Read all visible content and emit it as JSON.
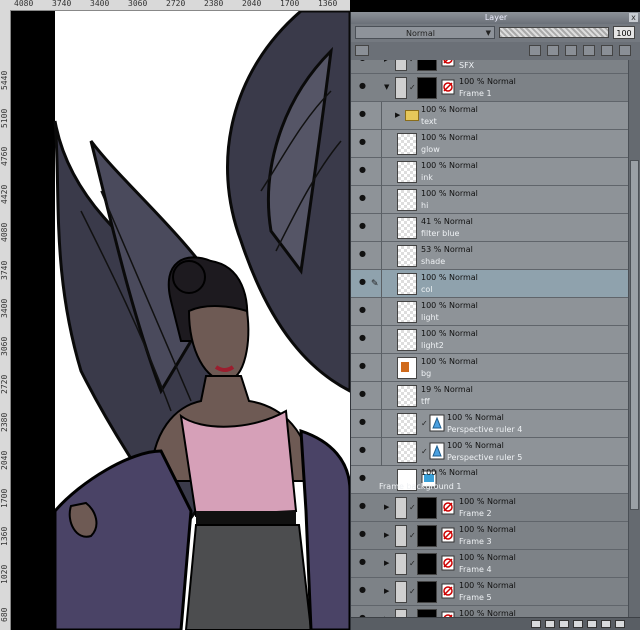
{
  "ruler": {
    "top_ticks": [
      "4080",
      "3740",
      "3400",
      "3060",
      "2720",
      "2380",
      "2040",
      "1700",
      "1360"
    ],
    "left_ticks": [
      "5440",
      "5100",
      "4760",
      "4420",
      "4080",
      "3740",
      "3400",
      "3060",
      "2720",
      "2380",
      "2040",
      "1700",
      "1360",
      "1020",
      "680",
      "340"
    ]
  },
  "panel": {
    "title": "Layer",
    "blend_mode": "Normal",
    "opacity": "100",
    "close_glyph": "x"
  },
  "layers": [
    {
      "name": "SFX",
      "opacity": "",
      "type": "partial"
    },
    {
      "name": "Frame 1",
      "opacity": "100 %  Normal",
      "type": "frame-open"
    },
    {
      "name": "text",
      "opacity": "100 %  Normal",
      "type": "folder"
    },
    {
      "name": "glow",
      "opacity": "100 %  Normal",
      "type": "raster"
    },
    {
      "name": "ink",
      "opacity": "100 %  Normal",
      "type": "raster"
    },
    {
      "name": "hi",
      "opacity": "100 %  Normal",
      "type": "raster"
    },
    {
      "name": "filter blue",
      "opacity": "41 %  Normal",
      "type": "raster"
    },
    {
      "name": "shade",
      "opacity": "53 %  Normal",
      "type": "raster"
    },
    {
      "name": "col",
      "opacity": "100 %  Normal",
      "type": "selected"
    },
    {
      "name": "light",
      "opacity": "100 %  Normal",
      "type": "raster"
    },
    {
      "name": "light2",
      "opacity": "100 %  Normal",
      "type": "raster"
    },
    {
      "name": "bg",
      "opacity": "100 %  Normal",
      "type": "raster-orange"
    },
    {
      "name": "tff",
      "opacity": "19 %  Normal",
      "type": "raster"
    },
    {
      "name": "Perspective ruler 4",
      "opacity": "100 %  Normal",
      "type": "perspective"
    },
    {
      "name": "Perspective ruler 5",
      "opacity": "100 %  Normal",
      "type": "perspective"
    },
    {
      "name": "Frame background 1",
      "opacity": "100 %  Normal",
      "type": "background"
    },
    {
      "name": "Frame 2",
      "opacity": "100 %  Normal",
      "type": "frame"
    },
    {
      "name": "Frame 3",
      "opacity": "100 %  Normal",
      "type": "frame"
    },
    {
      "name": "Frame 4",
      "opacity": "100 %  Normal",
      "type": "frame"
    },
    {
      "name": "Frame 5",
      "opacity": "100 %  Normal",
      "type": "frame"
    },
    {
      "name": "",
      "opacity": "100 %  Normal",
      "type": "frame"
    }
  ],
  "colors": {
    "panel_bg": "#6f747b",
    "row_bg": "#8e9398",
    "selected_row": "#8fa2ad",
    "skin": "#6e5a54",
    "top_pink": "#d6a0b8",
    "wings": "#3a3a4a",
    "jacket": "#4a4366",
    "pants": "#4c4d4f"
  }
}
